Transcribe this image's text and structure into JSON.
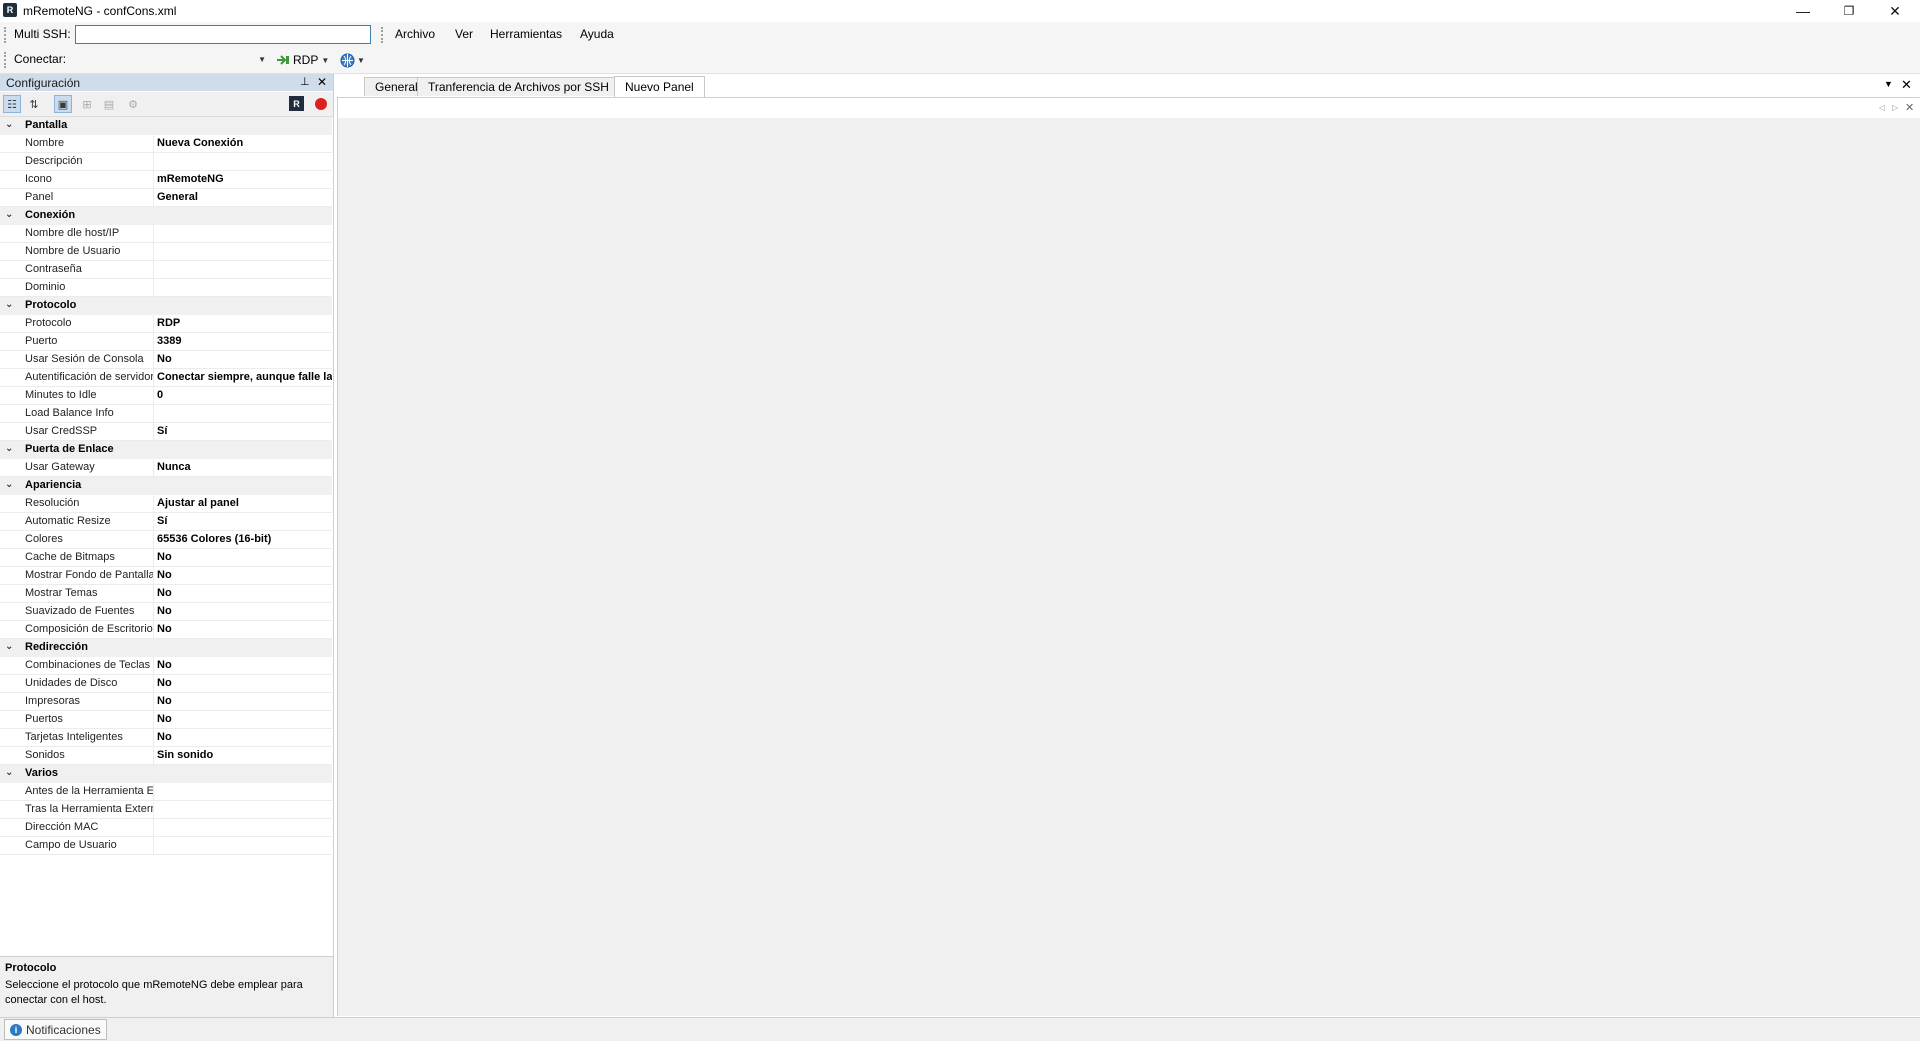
{
  "window": {
    "title": "mRemoteNG - confCons.xml",
    "app_icon_glyph": "R",
    "minimize_glyph": "—",
    "maximize_glyph": "❐",
    "close_glyph": "✕"
  },
  "toolbar": {
    "multi_ssh_label": "Multi SSH:",
    "multi_ssh_value": "",
    "menu": [
      "Archivo",
      "Ver",
      "Herramientas",
      "Ayuda"
    ],
    "connect_label": "Conectar:",
    "connect_value": "",
    "protocol_button": "RDP"
  },
  "config_pane": {
    "title": "Configuración",
    "pin_glyph": "📌",
    "close_glyph": "✕",
    "categories": [
      {
        "name": "Pantalla",
        "props": [
          [
            "Nombre",
            "Nueva Conexión"
          ],
          [
            "Descripción",
            ""
          ],
          [
            "Icono",
            "mRemoteNG"
          ],
          [
            "Panel",
            "General"
          ]
        ]
      },
      {
        "name": "Conexión",
        "props": [
          [
            "Nombre dle host/IP",
            ""
          ],
          [
            "Nombre de Usuario",
            ""
          ],
          [
            "Contraseña",
            ""
          ],
          [
            "Dominio",
            ""
          ]
        ]
      },
      {
        "name": "Protocolo",
        "props": [
          [
            "Protocolo",
            "RDP"
          ],
          [
            "Puerto",
            "3389"
          ],
          [
            "Usar Sesión de Consola",
            "No"
          ],
          [
            "Autentificación de servidor",
            "Conectar siempre, aunque falle la"
          ],
          [
            "Minutes to Idle",
            "0"
          ],
          [
            "Load Balance Info",
            ""
          ],
          [
            "Usar CredSSP",
            "Sí"
          ]
        ]
      },
      {
        "name": "Puerta de Enlace",
        "props": [
          [
            "Usar Gateway",
            "Nunca"
          ]
        ]
      },
      {
        "name": "Apariencia",
        "props": [
          [
            "Resolución",
            "Ajustar al panel"
          ],
          [
            "Automatic Resize",
            "Sí"
          ],
          [
            "Colores",
            "65536 Colores (16-bit)"
          ],
          [
            "Cache de Bitmaps",
            "No"
          ],
          [
            "Mostrar Fondo de Pantalla",
            "No"
          ],
          [
            "Mostrar Temas",
            "No"
          ],
          [
            "Suavizado de Fuentes",
            "No"
          ],
          [
            "Composición de Escritorio",
            "No"
          ]
        ]
      },
      {
        "name": "Redirección",
        "props": [
          [
            "Combinaciones de Teclas",
            "No"
          ],
          [
            "Unidades de Disco",
            "No"
          ],
          [
            "Impresoras",
            "No"
          ],
          [
            "Puertos",
            "No"
          ],
          [
            "Tarjetas Inteligentes",
            "No"
          ],
          [
            "Sonidos",
            "Sin sonido"
          ]
        ]
      },
      {
        "name": "Varios",
        "props": [
          [
            "Antes de la Herramienta Externa",
            ""
          ],
          [
            "Tras la Herramienta Externa",
            ""
          ],
          [
            "Dirección MAC",
            ""
          ],
          [
            "Campo de Usuario",
            ""
          ]
        ]
      }
    ],
    "help_title": "Protocolo",
    "help_text": "Seleccione el protocolo que mRemoteNG debe emplear para conectar con el host."
  },
  "tabs": [
    "General",
    "Tranferencia de Archivos por SSH",
    "Nuevo Panel"
  ],
  "active_tab": "Nuevo Panel",
  "statusbar": {
    "notifications_label": "Notificaciones"
  },
  "colors": {
    "pane_header": "#cfdcea",
    "accent": "#3c7fb1",
    "record": "#e02020"
  }
}
